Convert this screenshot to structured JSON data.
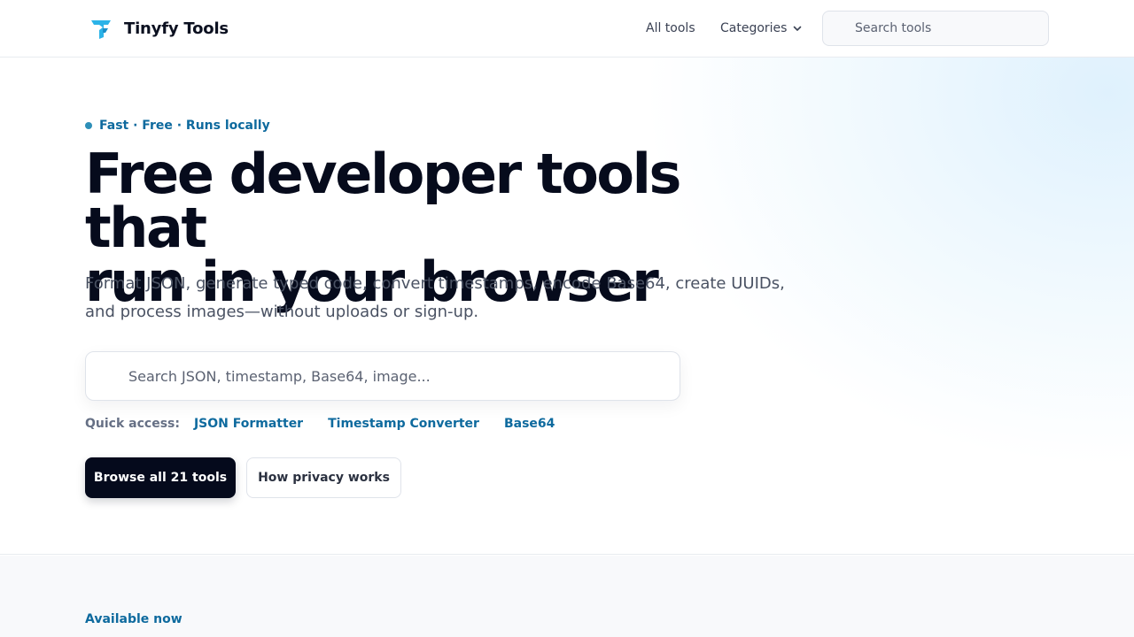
{
  "header": {
    "brand_name": "Tinyfy Tools",
    "nav": {
      "all_tools": "All tools",
      "categories": "Categories"
    },
    "search_placeholder": "Search tools"
  },
  "hero": {
    "eyebrow": "Fast · Free · Runs locally",
    "headline_line1": "Free developer tools that",
    "headline_line2": "run in your browser",
    "subline": "Format JSON, generate typed code, convert timestamps, encode Base64, create UUIDs, and process images—without uploads or sign-up.",
    "search_placeholder": "Search JSON, timestamp, Base64, image...",
    "quick_access": {
      "label": "Quick access:",
      "links": [
        "JSON Formatter",
        "Timestamp Converter",
        "Base64"
      ]
    },
    "buttons": {
      "primary": "Browse all 21 tools",
      "secondary": "How privacy works"
    }
  },
  "lower": {
    "section_label": "Available now"
  },
  "colors": {
    "accent": "#0e6a9e",
    "primary_button": "#050a1c",
    "logo": "#2bb3e8"
  },
  "icons": {
    "logo": "tinyfy-logo-icon",
    "categories_caret": "chevron-down-icon"
  }
}
